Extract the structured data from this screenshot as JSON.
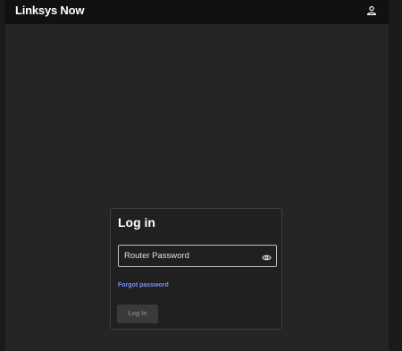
{
  "header": {
    "brand": "Linksys Now",
    "account_icon": "person-icon"
  },
  "login": {
    "title": "Log in",
    "password_placeholder": "Router Password",
    "password_value": "",
    "show_password_icon": "eye-icon",
    "forgot_link": "Forgot password",
    "submit_label": "Log In",
    "submit_enabled": false
  },
  "colors": {
    "background": "#252525",
    "header": "#111111",
    "card": "#202020",
    "link": "#7b8ff2",
    "button_disabled": "#3a3a3a"
  }
}
